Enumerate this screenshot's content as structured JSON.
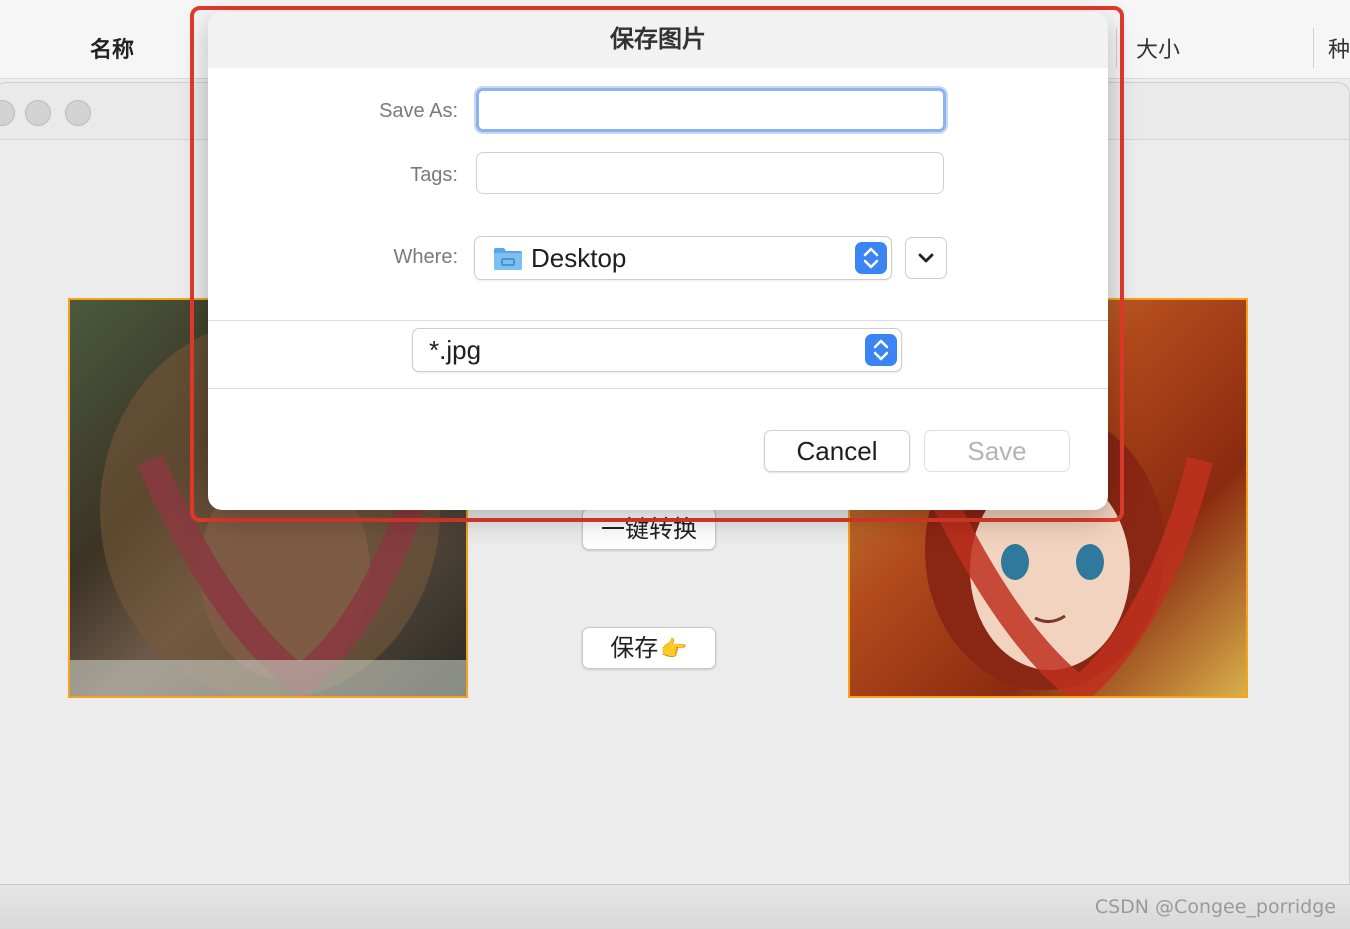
{
  "finder": {
    "col_name": "名称",
    "col_size": "大小",
    "col_kind": "种"
  },
  "app": {
    "convert_button": "一键转换",
    "save_button": "保存",
    "save_button_emoji": "👉"
  },
  "dialog": {
    "title": "保存图片",
    "save_as_label": "Save As:",
    "save_as_value": "",
    "tags_label": "Tags:",
    "tags_value": "",
    "where_label": "Where:",
    "where_value": "Desktop",
    "file_type": "*.jpg",
    "cancel_button": "Cancel",
    "save_button": "Save"
  },
  "colors": {
    "highlight": "#e23b2b",
    "accent": "#3a84f3",
    "photo_border": "#f6a21b"
  },
  "watermark": "CSDN @Congee_porridge"
}
